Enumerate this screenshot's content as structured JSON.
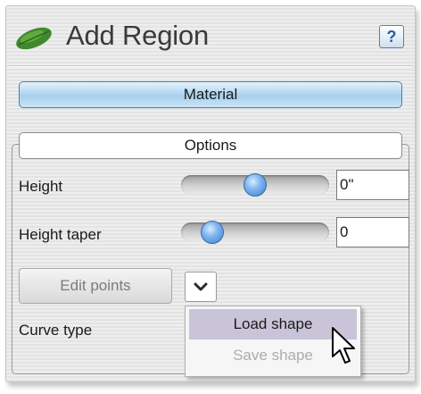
{
  "header": {
    "title": "Add Region",
    "help_label": "?",
    "icon": "leaf-icon"
  },
  "material": {
    "label": "Material"
  },
  "options": {
    "label": "Options",
    "height": {
      "label": "Height",
      "value": "0\"",
      "slider_fraction": 0.5
    },
    "height_taper": {
      "label": "Height taper",
      "value": "0",
      "slider_fraction": 0.21
    },
    "edit_points_label": "Edit points",
    "dropdown_icon": "chevron-down-icon",
    "curve_type_label": "Curve type"
  },
  "shape_menu": {
    "items": [
      {
        "label": "Load shape",
        "state": "highlighted"
      },
      {
        "label": "Save shape",
        "state": "disabled"
      }
    ]
  },
  "colors": {
    "accent": "#a8d0ee",
    "slider_thumb": "#5a9ae2",
    "menu_highlight": "#c9c4d8",
    "leaf_green": "#3f8a2c"
  }
}
